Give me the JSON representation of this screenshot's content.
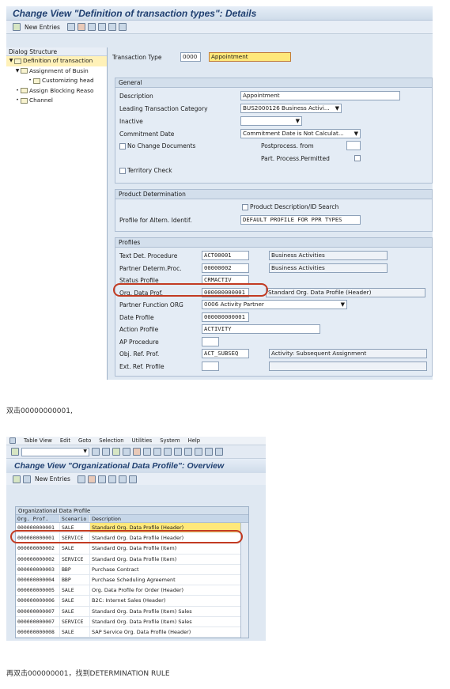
{
  "shot1": {
    "title": "Change View \"Definition of transaction types\": Details",
    "new_entries": "New Entries",
    "dialog_structure": "Dialog Structure",
    "tree": [
      {
        "label": "Definition of transaction"
      },
      {
        "label": "Assignment of Busin"
      },
      {
        "label": "Customizing head"
      },
      {
        "label": "Assign Blocking Reaso"
      },
      {
        "label": "Channel"
      }
    ],
    "transaction_type_label": "Transaction Type",
    "transaction_type_value": "0000",
    "transaction_type_desc": "Appointment",
    "general": {
      "header": "General",
      "description_label": "Description",
      "description_value": "Appointment",
      "leading_cat_label": "Leading Transaction Category",
      "leading_cat_value": "BUS2000126 Business Activi...",
      "inactive_label": "Inactive",
      "commitment_label": "Commitment Date",
      "commitment_value": "Commitment Date is Not Calculat...",
      "no_change_docs": "No Change Documents",
      "postprocess_label": "Postprocess. from",
      "part_process_label": "Part. Process.Permitted",
      "territory_check": "Territory Check"
    },
    "product": {
      "header": "Product Determination",
      "product_desc_check": "Product Description/ID Search",
      "altern_label": "Profile for Altern. Identif.",
      "altern_value": "DEFAULT PROFILE FOR PPR TYPES"
    },
    "profiles": {
      "header": "Profiles",
      "rows": [
        {
          "label": "Text Det. Procedure",
          "value": "ACT00001",
          "desc": "Business Activities"
        },
        {
          "label": "Partner Determ.Proc.",
          "value": "00000002",
          "desc": "Business Activities"
        },
        {
          "label": "Status Profile",
          "value": "CRMACTIV",
          "desc": ""
        },
        {
          "label": "Org. Data Prof.",
          "value": "000000000001",
          "desc": "Standard Org. Data Profile (Header)"
        },
        {
          "label": "Partner Function ORG",
          "value": "0006 Activity Partner",
          "desc": ""
        },
        {
          "label": "Date Profile",
          "value": "000000000001",
          "desc": ""
        },
        {
          "label": "Action Profile",
          "value": "ACTIVITY",
          "desc": ""
        },
        {
          "label": "AP Procedure",
          "value": "",
          "desc": ""
        },
        {
          "label": "Obj. Ref. Prof.",
          "value": "ACT_SUBSEQ",
          "desc": "Activity: Subsequent Assignment"
        },
        {
          "label": "Ext. Ref. Profile",
          "value": "",
          "desc": ""
        }
      ]
    }
  },
  "caption1": "双击00000000001,",
  "shot2": {
    "menu": [
      "Table View",
      "Edit",
      "Goto",
      "Selection",
      "Utilities",
      "System",
      "Help"
    ],
    "title": "Change View \"Organizational Data Profile\": Overview",
    "new_entries": "New Entries",
    "table_header": "Organizational Data Profile",
    "columns": [
      "Org. Prof.",
      "Scenario",
      "Description"
    ],
    "rows": [
      [
        "000000000001",
        "SALE",
        "Standard Org. Data Profile (Header)"
      ],
      [
        "000000000001",
        "SERVICE",
        "Standard Org. Data Profile (Header)"
      ],
      [
        "000000000002",
        "SALE",
        "Standard Org. Data Profile (Item)"
      ],
      [
        "000000000002",
        "SERVICE",
        "Standard Org. Data Profile (Item)"
      ],
      [
        "000000000003",
        "BBP",
        "Purchase Contract"
      ],
      [
        "000000000004",
        "BBP",
        "Purchase Scheduling Agreement"
      ],
      [
        "000000000005",
        "SALE",
        "Org. Data Profile for Order (Header)"
      ],
      [
        "000000000006",
        "SALE",
        "B2C: Internet Sales (Header)"
      ],
      [
        "000000000007",
        "SALE",
        "Standard Org. Data Profile (Item) Sales"
      ],
      [
        "000000000007",
        "SERVICE",
        "Standard Org. Data Profile (Item) Sales"
      ],
      [
        "000000000008",
        "SALE",
        "SAP Service Org. Data Profile (Header)"
      ]
    ]
  },
  "caption2": "再双击000000001，找到DETERMINATION RULE"
}
